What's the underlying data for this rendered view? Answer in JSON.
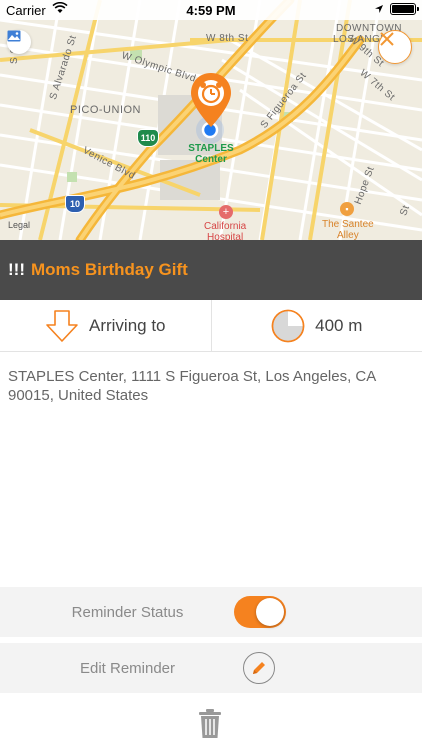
{
  "status_bar": {
    "carrier": "Carrier",
    "time": "4:59 PM"
  },
  "map": {
    "street_labels": {
      "w8th": "W 8th St",
      "w9th": "W 9th St",
      "w7th": "W 7th St",
      "olympic": "W Olympic Blvd",
      "figueroa": "S Figueroa St",
      "alvarado": "S Alvarado St",
      "venice": "Venice Blvd",
      "hope": "Hope St",
      "s_st": "S St",
      "st_right": "St"
    },
    "area_labels": {
      "pico_union": "PICO-UNION",
      "downtown_1": "DOWNTOWN",
      "downtown_2": "LOS ANGELES"
    },
    "poi": {
      "staples_1": "STAPLES",
      "staples_2": "Center",
      "california_1": "California",
      "california_2": "Hospital",
      "santee_1": "The Santee",
      "santee_2": "Alley"
    },
    "shields": {
      "hwy110": "110",
      "i10": "10"
    },
    "legal": "Legal"
  },
  "reminder": {
    "priority": "!!!",
    "title": "Moms Birthday Gift",
    "trigger_label": "Arriving to",
    "radius_label": "400 m",
    "address": "STAPLES Center, 1111 S Figueroa St, Los Angeles, CA 90015, United States"
  },
  "controls": {
    "status_label": "Reminder Status",
    "status_on": true,
    "edit_label": "Edit Reminder"
  },
  "colors": {
    "accent": "#f5821f",
    "title_bar": "#4a4a4a"
  }
}
